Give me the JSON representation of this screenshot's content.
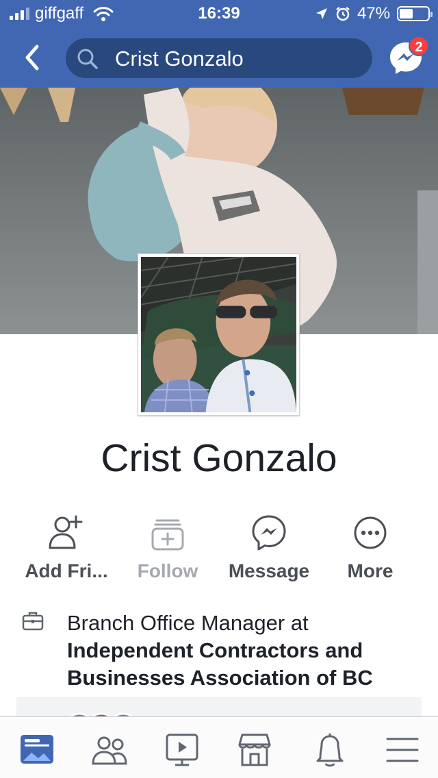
{
  "status_bar": {
    "carrier": "giffgaff",
    "time": "16:39",
    "battery_text": "47%",
    "battery_level": 0.47
  },
  "nav": {
    "search_value": "Crist Gonzalo",
    "messenger_badge": "2",
    "accent_color": "#4267b2"
  },
  "profile": {
    "name": "Crist Gonzalo"
  },
  "actions": [
    {
      "label": "Add Fri...",
      "icon": "add-friend-icon"
    },
    {
      "label": "Follow",
      "icon": "follow-icon"
    },
    {
      "label": "Message",
      "icon": "messenger-icon"
    },
    {
      "label": "More",
      "icon": "more-icon"
    }
  ],
  "work": {
    "prefix": "Branch Office Manager at",
    "company": "Independent Contractors and Businesses Association of BC",
    "icon": "briefcase-icon"
  },
  "tabs": [
    {
      "icon": "news-feed-icon",
      "active": true
    },
    {
      "icon": "friends-icon",
      "active": false
    },
    {
      "icon": "watch-icon",
      "active": false
    },
    {
      "icon": "marketplace-icon",
      "active": false
    },
    {
      "icon": "notifications-icon",
      "active": false
    },
    {
      "icon": "menu-icon",
      "active": false
    }
  ]
}
